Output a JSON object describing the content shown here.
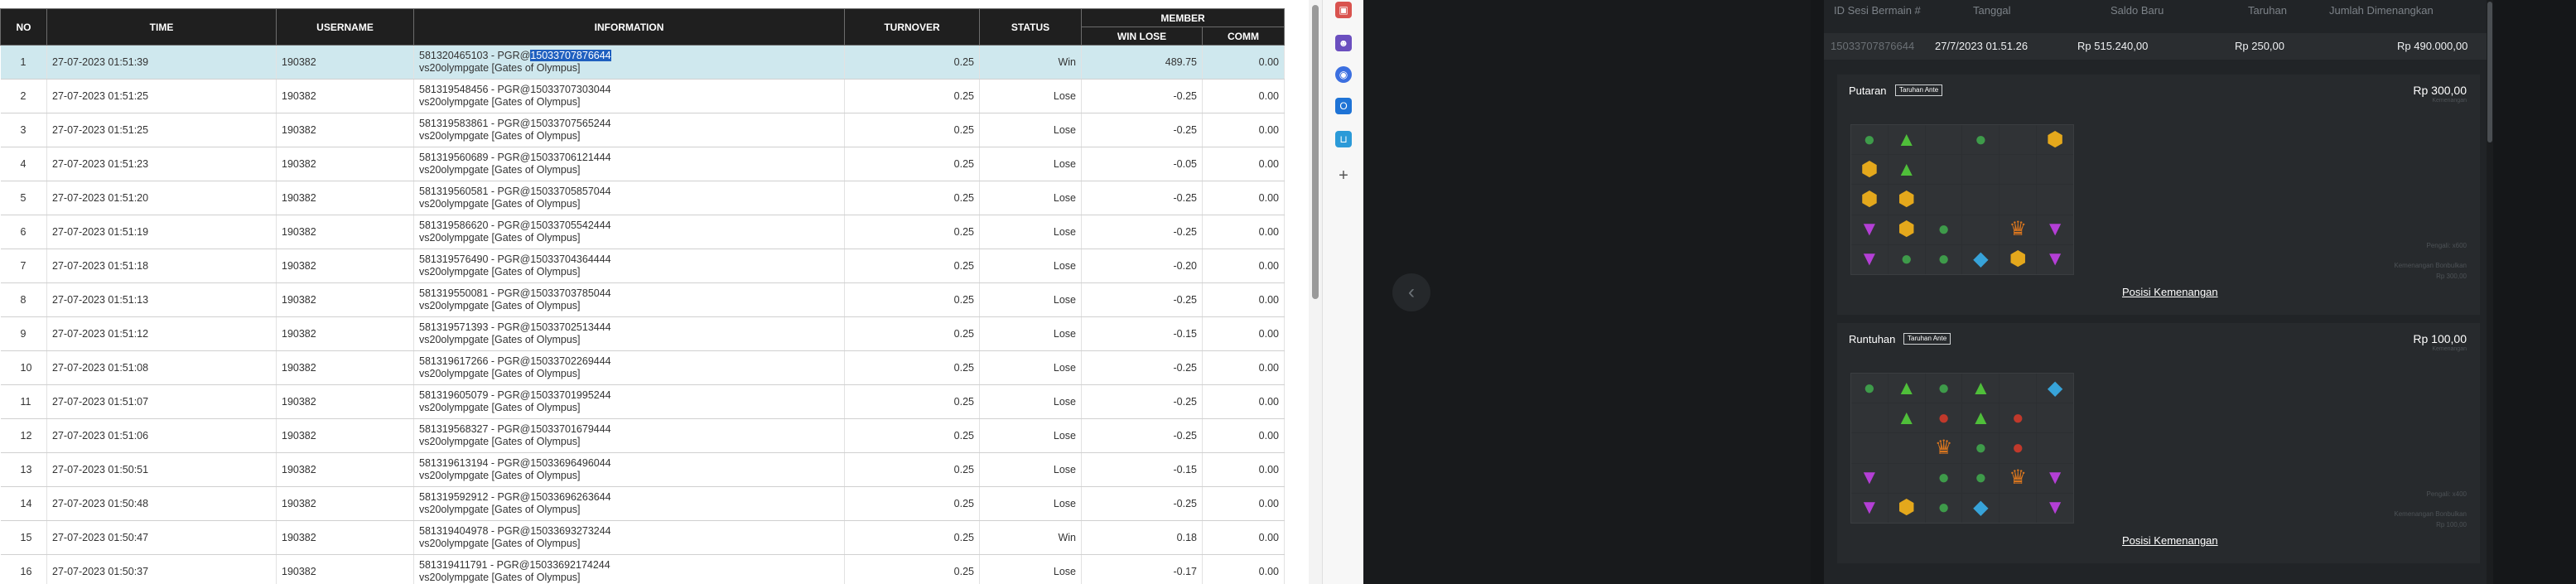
{
  "table": {
    "headers": {
      "no": "NO",
      "time": "TIME",
      "username": "USERNAME",
      "information": "INFORMATION",
      "turnover": "TURNOVER",
      "status": "STATUS",
      "member": "MEMBER",
      "win_lose": "WIN LOSE",
      "comm": "COMM"
    },
    "rows": [
      {
        "no": "1",
        "time": "27-07-2023 01:51:39",
        "username": "190382",
        "info_a": "581320465103 - PGR@",
        "info_hl": "15033707876644",
        "info_b": "vs20olympgate [Gates of Olympus]",
        "turnover": "0.25",
        "status": "Win",
        "winlose": "489.75",
        "comm": "0.00"
      },
      {
        "no": "2",
        "time": "27-07-2023 01:51:25",
        "username": "190382",
        "info_a": "581319548456 - PGR@15033707303044",
        "info_hl": "",
        "info_b": "vs20olympgate [Gates of Olympus]",
        "turnover": "0.25",
        "status": "Lose",
        "winlose": "-0.25",
        "comm": "0.00"
      },
      {
        "no": "3",
        "time": "27-07-2023 01:51:25",
        "username": "190382",
        "info_a": "581319583861 - PGR@15033707565244",
        "info_hl": "",
        "info_b": "vs20olympgate [Gates of Olympus]",
        "turnover": "0.25",
        "status": "Lose",
        "winlose": "-0.25",
        "comm": "0.00"
      },
      {
        "no": "4",
        "time": "27-07-2023 01:51:23",
        "username": "190382",
        "info_a": "581319560689 - PGR@15033706121444",
        "info_hl": "",
        "info_b": "vs20olympgate [Gates of Olympus]",
        "turnover": "0.25",
        "status": "Lose",
        "winlose": "-0.05",
        "comm": "0.00"
      },
      {
        "no": "5",
        "time": "27-07-2023 01:51:20",
        "username": "190382",
        "info_a": "581319560581 - PGR@15033705857044",
        "info_hl": "",
        "info_b": "vs20olympgate [Gates of Olympus]",
        "turnover": "0.25",
        "status": "Lose",
        "winlose": "-0.25",
        "comm": "0.00"
      },
      {
        "no": "6",
        "time": "27-07-2023 01:51:19",
        "username": "190382",
        "info_a": "581319586620 - PGR@15033705542444",
        "info_hl": "",
        "info_b": "vs20olympgate [Gates of Olympus]",
        "turnover": "0.25",
        "status": "Lose",
        "winlose": "-0.25",
        "comm": "0.00"
      },
      {
        "no": "7",
        "time": "27-07-2023 01:51:18",
        "username": "190382",
        "info_a": "581319576490 - PGR@15033704364444",
        "info_hl": "",
        "info_b": "vs20olympgate [Gates of Olympus]",
        "turnover": "0.25",
        "status": "Lose",
        "winlose": "-0.20",
        "comm": "0.00"
      },
      {
        "no": "8",
        "time": "27-07-2023 01:51:13",
        "username": "190382",
        "info_a": "581319550081 - PGR@15033703785044",
        "info_hl": "",
        "info_b": "vs20olympgate [Gates of Olympus]",
        "turnover": "0.25",
        "status": "Lose",
        "winlose": "-0.25",
        "comm": "0.00"
      },
      {
        "no": "9",
        "time": "27-07-2023 01:51:12",
        "username": "190382",
        "info_a": "581319571393 - PGR@15033702513444",
        "info_hl": "",
        "info_b": "vs20olympgate [Gates of Olympus]",
        "turnover": "0.25",
        "status": "Lose",
        "winlose": "-0.15",
        "comm": "0.00"
      },
      {
        "no": "10",
        "time": "27-07-2023 01:51:08",
        "username": "190382",
        "info_a": "581319617266 - PGR@15033702269444",
        "info_hl": "",
        "info_b": "vs20olympgate [Gates of Olympus]",
        "turnover": "0.25",
        "status": "Lose",
        "winlose": "-0.25",
        "comm": "0.00"
      },
      {
        "no": "11",
        "time": "27-07-2023 01:51:07",
        "username": "190382",
        "info_a": "581319605079 - PGR@15033701995244",
        "info_hl": "",
        "info_b": "vs20olympgate [Gates of Olympus]",
        "turnover": "0.25",
        "status": "Lose",
        "winlose": "-0.25",
        "comm": "0.00"
      },
      {
        "no": "12",
        "time": "27-07-2023 01:51:06",
        "username": "190382",
        "info_a": "581319568327 - PGR@15033701679444",
        "info_hl": "",
        "info_b": "vs20olympgate [Gates of Olympus]",
        "turnover": "0.25",
        "status": "Lose",
        "winlose": "-0.25",
        "comm": "0.00"
      },
      {
        "no": "13",
        "time": "27-07-2023 01:50:51",
        "username": "190382",
        "info_a": "581319613194 - PGR@15033696496044",
        "info_hl": "",
        "info_b": "vs20olympgate [Gates of Olympus]",
        "turnover": "0.25",
        "status": "Lose",
        "winlose": "-0.15",
        "comm": "0.00"
      },
      {
        "no": "14",
        "time": "27-07-2023 01:50:48",
        "username": "190382",
        "info_a": "581319592912 - PGR@15033696263644",
        "info_hl": "",
        "info_b": "vs20olympgate [Gates of Olympus]",
        "turnover": "0.25",
        "status": "Lose",
        "winlose": "-0.25",
        "comm": "0.00"
      },
      {
        "no": "15",
        "time": "27-07-2023 01:50:47",
        "username": "190382",
        "info_a": "581319404978 - PGR@15033693273244",
        "info_hl": "",
        "info_b": "vs20olympgate [Gates of Olympus]",
        "turnover": "0.25",
        "status": "Win",
        "winlose": "0.18",
        "comm": "0.00"
      },
      {
        "no": "16",
        "time": "27-07-2023 01:50:37",
        "username": "190382",
        "info_a": "581319411791 - PGR@15033692174244",
        "info_hl": "",
        "info_b": "vs20olympgate [Gates of Olympus]",
        "turnover": "0.25",
        "status": "Lose",
        "winlose": "-0.17",
        "comm": "0.00"
      }
    ]
  },
  "sidebar_icons": [
    "gift-icon",
    "people-icon",
    "globe-icon",
    "outlook-icon",
    "cart-icon",
    "plus-icon"
  ],
  "detail": {
    "headers": {
      "session_id": "ID Sesi Bermain #",
      "date": "Tanggal",
      "new_balance": "Saldo Baru",
      "bet": "Taruhan",
      "total_won": "Jumlah Dimenangkan"
    },
    "row": {
      "session_id": "15033707876644",
      "date": "27/7/2023 01.51.26",
      "new_balance": "Rp 515.240,00",
      "bet": "Rp 250,00",
      "total_won": "Rp 490.000,00"
    },
    "cards": [
      {
        "title": "Putaran",
        "badge": "Taruhan Ante",
        "amount": "Rp 300,00",
        "amount_sub": "Kemenangan",
        "note1": "Pengali: x600",
        "note2": "Kemenangan Bonbulkan",
        "note3": "Rp 300,00",
        "link": "Posisi Kemenangan",
        "grid": [
          [
            "gem-green",
            "tri-green",
            "",
            "gem-green",
            "",
            "hex-gold"
          ],
          [
            "hex-gold",
            "tri-green",
            "",
            "",
            "",
            ""
          ],
          [
            "hex-gold",
            "hex-gold",
            "",
            "",
            "",
            ""
          ],
          [
            "tri-purple",
            "hex-gold",
            "gem-green",
            "",
            "crown",
            "tri-purple"
          ],
          [
            "tri-purple",
            "gem-green",
            "gem-green",
            "diamond-blue",
            "hex-gold",
            "tri-purple"
          ]
        ]
      },
      {
        "title": "Runtuhan",
        "badge": "Taruhan Ante",
        "amount": "Rp 100,00",
        "amount_sub": "Kemenangan",
        "note1": "Pengali: x400",
        "note2": "Kemenangan Bonbulkan",
        "note3": "Rp 100,00",
        "link": "Posisi Kemenangan",
        "grid": [
          [
            "gem-green",
            "tri-green",
            "gem-green",
            "tri-green",
            "",
            "diamond-blue"
          ],
          [
            "",
            "tri-green",
            "gem-red",
            "tri-green",
            "gem-red",
            ""
          ],
          [
            "",
            "",
            "crown",
            "gem-green",
            "gem-red",
            ""
          ],
          [
            "tri-purple",
            "",
            "gem-green",
            "gem-green",
            "crown",
            "tri-purple"
          ],
          [
            "tri-purple",
            "hex-gold",
            "gem-green",
            "diamond-blue",
            "",
            "tri-purple"
          ]
        ]
      }
    ]
  }
}
